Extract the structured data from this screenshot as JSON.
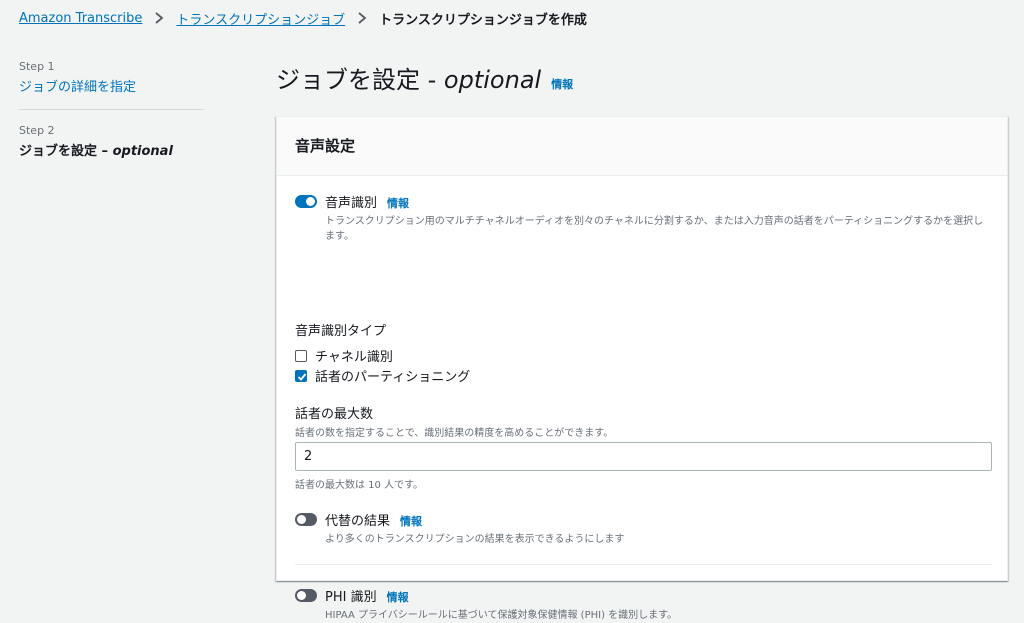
{
  "breadcrumb": {
    "items": [
      "Amazon Transcribe",
      "トランスクリプションジョブ"
    ],
    "current": "トランスクリプションジョブを作成"
  },
  "steps": [
    {
      "label": "Step 1",
      "title": "ジョブの詳細を指定"
    },
    {
      "label": "Step 2",
      "title": "ジョブを設定",
      "suffix": "optional"
    }
  ],
  "page": {
    "title": "ジョブを設定 - ",
    "title_suffix": "optional",
    "info": "情報"
  },
  "audio_settings": {
    "header": "音声設定",
    "audio_identification": {
      "label": "音声識別",
      "info": "情報",
      "enabled": true,
      "description": "トランスクリプション用のマルチチャネルオーディオを別々のチャネルに分割するか、または入力音声の話者をパーティショニングするかを選択します。"
    },
    "identification_type": {
      "label": "音声識別タイプ",
      "options": [
        {
          "label": "チャネル識別",
          "checked": false
        },
        {
          "label": "話者のパーティショニング",
          "checked": true
        }
      ]
    },
    "max_speakers": {
      "label": "話者の最大数",
      "description": "話者の数を指定することで、識別結果の精度を高めることができます。",
      "value": "2",
      "hint": "話者の最大数は 10 人です。"
    },
    "alternative_results": {
      "label": "代替の結果",
      "info": "情報",
      "enabled": false,
      "description": "より多くのトランスクリプションの結果を表示できるようにします"
    },
    "phi_identification": {
      "label": "PHI 識別",
      "info": "情報",
      "enabled": false,
      "description": "HIPAA プライバシールールに基づいて保護対象保健情報 (PHI) を識別します。"
    }
  },
  "colors": {
    "link": "#0073bb",
    "toggle_on": "#0073bb",
    "toggle_off": "#545b64",
    "background": "#f2f3f3"
  }
}
